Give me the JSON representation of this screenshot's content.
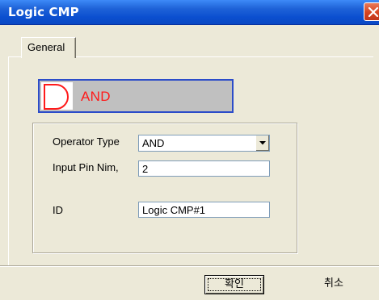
{
  "window": {
    "title": "Logic CMP"
  },
  "tabs": [
    {
      "label": "General"
    }
  ],
  "preview": {
    "label": "AND",
    "label_color": "#ff1a1a",
    "border_color": "#2b4cc9",
    "icon": "and-gate-icon"
  },
  "form": {
    "operator_type": {
      "label": "Operator Type",
      "value": "AND"
    },
    "input_pin": {
      "label": "Input Pin Nim,",
      "value": "2"
    },
    "id": {
      "label": "ID",
      "value": "Logic CMP#1"
    }
  },
  "buttons": {
    "ok_label": "확인",
    "cancel_label": "취소"
  },
  "colors": {
    "titlebar": "#0b4fd0",
    "close_button": "#d6441f",
    "dialog_bg": "#ece9d8"
  }
}
